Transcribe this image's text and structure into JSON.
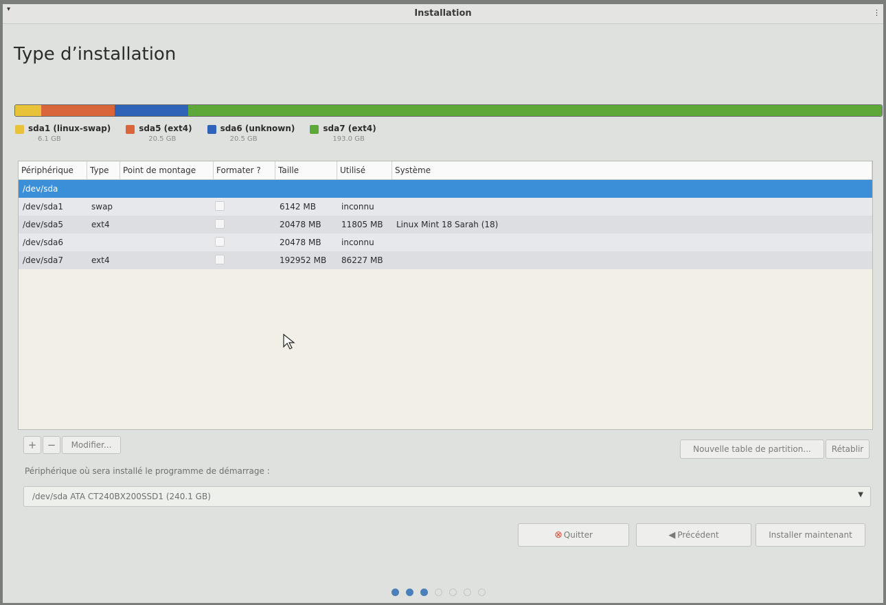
{
  "window": {
    "title": "Installation"
  },
  "page_title": "Type d’installation",
  "partition_bar": {
    "segments": [
      {
        "name": "sda1",
        "color": "#e8c33a",
        "fraction": 0.03
      },
      {
        "name": "sda5",
        "color": "#d9663a",
        "fraction": 0.085
      },
      {
        "name": "sda6",
        "color": "#2f63b8",
        "fraction": 0.085
      },
      {
        "name": "sda7",
        "color": "#5ea83a",
        "fraction": 0.8
      }
    ]
  },
  "legend": [
    {
      "label": "sda1 (linux-swap)",
      "size": "6.1 GB",
      "color": "#e8c33a"
    },
    {
      "label": "sda5 (ext4)",
      "size": "20.5 GB",
      "color": "#d9663a"
    },
    {
      "label": "sda6 (unknown)",
      "size": "20.5 GB",
      "color": "#2f63b8"
    },
    {
      "label": "sda7 (ext4)",
      "size": "193.0 GB",
      "color": "#5ea83a"
    }
  ],
  "table": {
    "columns": [
      "Périphérique",
      "Type",
      "Point de montage",
      "Formater ?",
      "Taille",
      "Utilisé",
      "Système"
    ],
    "device_row": "/dev/sda",
    "rows": [
      {
        "device": "/dev/sda1",
        "type": "swap",
        "mount": "",
        "size": "6142 MB",
        "used": "inconnu",
        "system": ""
      },
      {
        "device": "/dev/sda5",
        "type": "ext4",
        "mount": "",
        "size": "20478 MB",
        "used": "11805 MB",
        "system": "Linux Mint 18 Sarah (18)"
      },
      {
        "device": "/dev/sda6",
        "type": "",
        "mount": "",
        "size": "20478 MB",
        "used": "inconnu",
        "system": ""
      },
      {
        "device": "/dev/sda7",
        "type": "ext4",
        "mount": "",
        "size": "192952 MB",
        "used": "86227 MB",
        "system": ""
      }
    ]
  },
  "toolbar": {
    "add_label": "+",
    "remove_label": "−",
    "modify_label": "Modifier...",
    "new_table_label": "Nouvelle table de partition...",
    "revert_label": "Rétablir"
  },
  "bootloader": {
    "label": "Périphérique où sera installé le programme de démarrage :",
    "value": "/dev/sda   ATA CT240BX200SSD1 (240.1 GB)"
  },
  "buttons": {
    "quit_label": "Quitter",
    "back_label": "Précédent",
    "install_label": "Installer maintenant"
  },
  "progress": {
    "total_steps": 7,
    "completed_steps": 3
  }
}
